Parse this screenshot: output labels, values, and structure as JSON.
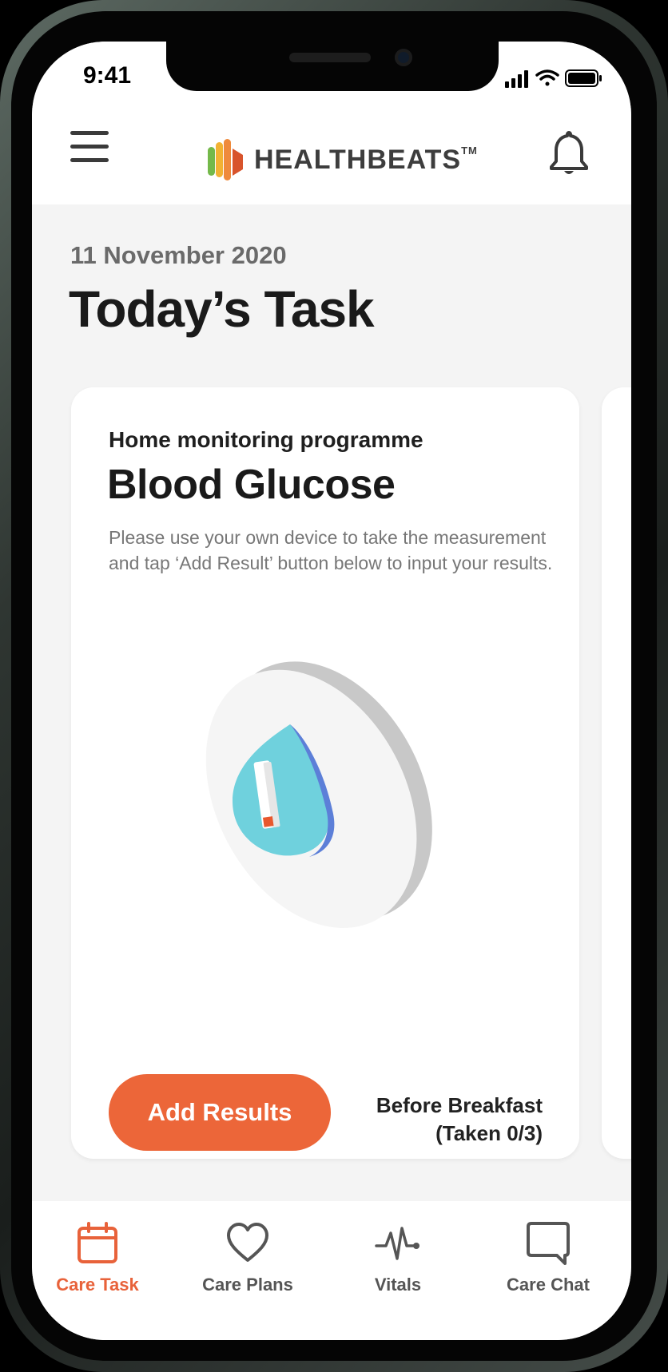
{
  "status_bar": {
    "time": "9:41"
  },
  "header": {
    "logo_text": "HEALTHBEATS",
    "logo_tm": "TM"
  },
  "page": {
    "date": "11 November 2020",
    "title": "Today’s Task"
  },
  "task_card": {
    "subtitle": "Home monitoring programme",
    "title": "Blood Glucose",
    "description": "Please use your own device to take the measurement and tap ‘Add Result’ button below to input your results.",
    "button_label": "Add Results",
    "reading_time": "Before Breakfast",
    "reading_count": "(Taken 0/3)"
  },
  "tabs": [
    {
      "label": "Care Task",
      "icon": "calendar-icon",
      "active": true
    },
    {
      "label": "Care Plans",
      "icon": "heart-icon",
      "active": false
    },
    {
      "label": "Vitals",
      "icon": "pulse-icon",
      "active": false
    },
    {
      "label": "Care Chat",
      "icon": "chat-bubble-icon",
      "active": false
    }
  ],
  "colors": {
    "accent": "#EC6639",
    "background": "#F4F4F4",
    "card": "#FFFFFF",
    "drop": "#6ED0DC"
  }
}
